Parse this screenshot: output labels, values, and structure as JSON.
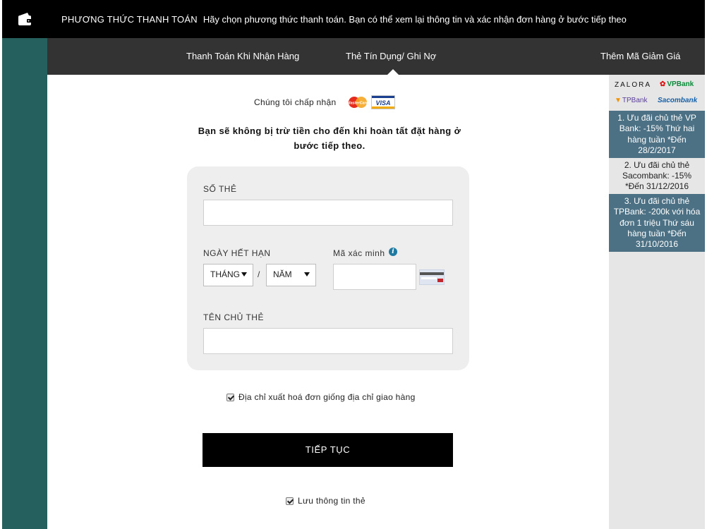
{
  "header": {
    "icon": "wallet-icon",
    "step_title": "PHƯƠNG THỨC THANH TOÁN",
    "step_description": "Hãy chọn phương thức thanh toán. Bạn có thể xem lại thông tin và xác nhận đơn hàng ở bước tiếp theo"
  },
  "tabs": [
    {
      "label": "Thanh Toán Khi Nhận Hàng",
      "active": false
    },
    {
      "label": "Thẻ Tín Dụng/ Ghi Nợ",
      "active": true
    },
    {
      "label": "Thêm Mã Giảm Giá",
      "active": false
    }
  ],
  "sidebar": {
    "logos": [
      "ZALORA",
      "VPBank",
      "TPBank",
      "Sacombank"
    ],
    "promos": [
      {
        "text": "1. Ưu đãi chủ thẻ VP Bank: -15% Thứ hai hàng tuần *Đến 28/2/2017",
        "style": "dark"
      },
      {
        "text": "2. Ưu đãi chủ thẻ Sacombank: -15% *Đến 31/12/2016",
        "style": "light"
      },
      {
        "text": "3. Ưu đãi chủ thẻ TPBank: -200k với hóa đơn 1 triệu Thứ sáu hàng tuần *Đến 31/10/2016",
        "style": "dark"
      }
    ]
  },
  "main": {
    "accept_label": "Chúng tôi chấp nhận",
    "accepted_cards": [
      "MasterCard",
      "VISA"
    ],
    "notice": "Bạn sẽ không bị trừ tiền cho đến khi hoàn tất đặt hàng ở bước tiếp theo.",
    "form": {
      "card_number_label": "SỐ THẺ",
      "card_number_value": "",
      "expiry_label": "NGÀY HẾT HẠN",
      "month_select": "THÁNG",
      "year_select": "NĂM",
      "separator": "/",
      "cvv_label": "Mã xác minh",
      "cvv_value": "",
      "holder_label": "TÊN CHỦ THẺ",
      "holder_value": ""
    },
    "billing_same_label": "Địa chỉ xuất hoá đơn giống địa chỉ giao hàng",
    "billing_same_checked": true,
    "continue_label": "TIẾP TỤC",
    "save_card_label": "Lưu thông tin thẻ",
    "save_card_checked": true
  },
  "colors": {
    "topbar": "#000000",
    "tabbar": "#333333",
    "leftbar": "#255f5e",
    "sidebar": "#e6e6e6",
    "promo_dark": "#4c7184",
    "card_box": "#eeeeee",
    "button": "#000000"
  }
}
